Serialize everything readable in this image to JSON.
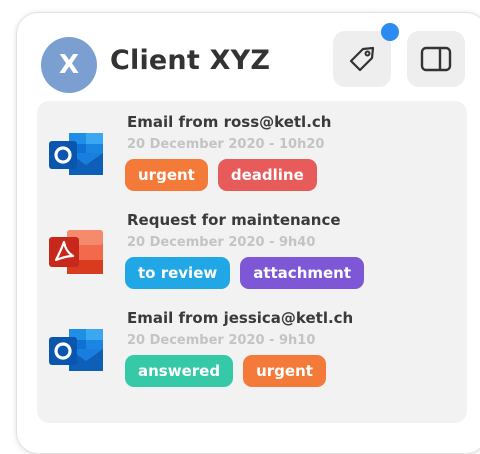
{
  "header": {
    "avatar_letter": "X",
    "title": "Client XYZ",
    "notification_color": "#2a8cf0"
  },
  "colors": {
    "urgent": "#f47a3a",
    "deadline": "#e85b5b",
    "to_review": "#22a7e6",
    "attachment": "#7e57d6",
    "answered": "#35c9a8",
    "list_background": "#f2f2f2"
  },
  "items": [
    {
      "app": "outlook-icon",
      "title": "Email from ross@ketl.ch",
      "date": "20 December 2020 - 10h20",
      "tags": [
        {
          "label": "urgent",
          "color": "#f47a3a"
        },
        {
          "label": "deadline",
          "color": "#e85b5b"
        }
      ]
    },
    {
      "app": "pdf-icon",
      "title": "Request for maintenance",
      "date": "20 December 2020 - 9h40",
      "tags": [
        {
          "label": "to review",
          "color": "#22a7e6"
        },
        {
          "label": "attachment",
          "color": "#7e57d6"
        }
      ]
    },
    {
      "app": "outlook-icon",
      "title": "Email from jessica@ketl.ch",
      "date": "20 December 2020 - 9h10",
      "tags": [
        {
          "label": "answered",
          "color": "#35c9a8"
        },
        {
          "label": "urgent",
          "color": "#f47a3a"
        }
      ]
    }
  ]
}
